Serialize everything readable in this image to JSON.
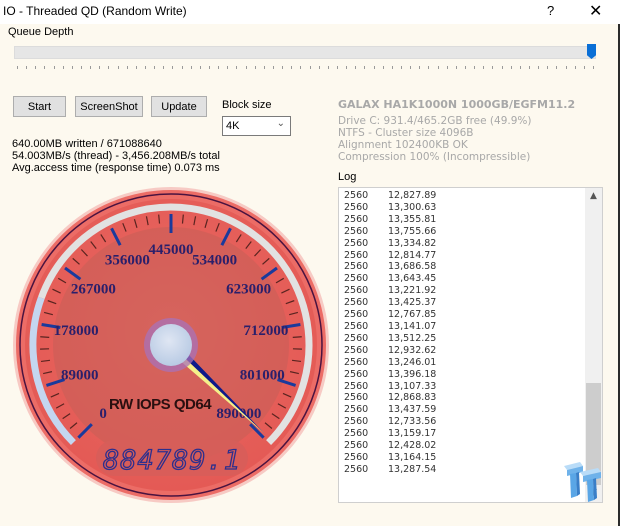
{
  "window": {
    "title": "IO - Threaded QD (Random Write)",
    "help_glyph": "?",
    "close_glyph": "✕"
  },
  "queue_depth": {
    "label": "Queue Depth",
    "slider_value_fraction": 1.0
  },
  "buttons": {
    "start": "Start",
    "screenshot": "ScreenShot",
    "update": "Update"
  },
  "block_size": {
    "label": "Block size",
    "selected": "4K"
  },
  "stats": {
    "written": "640.00MB written / 671088640",
    "throughput": "54.003MB/s (thread) - 3,456.208MB/s total",
    "access_time": "Avg.access time (response time) 0.073 ms"
  },
  "drive": {
    "title": "GALAX HA1K1000N 1000GB/EGFM11.2",
    "lines": [
      "Drive C: 931.4/465.2GB free (49.9%)",
      "NTFS - Cluster size 4096B",
      "Alignment 102400KB OK",
      "Compression 100% (Incompressible)"
    ]
  },
  "log": {
    "label": "Log",
    "rows": [
      [
        "2560",
        "12,827.89"
      ],
      [
        "2560",
        "13,300.63"
      ],
      [
        "2560",
        "13,355.81"
      ],
      [
        "2560",
        "13,755.66"
      ],
      [
        "2560",
        "13,334.82"
      ],
      [
        "2560",
        "12,814.77"
      ],
      [
        "2560",
        "13,686.58"
      ],
      [
        "2560",
        "13,643.45"
      ],
      [
        "2560",
        "13,221.92"
      ],
      [
        "2560",
        "13,425.37"
      ],
      [
        "2560",
        "12,767.85"
      ],
      [
        "2560",
        "13,141.07"
      ],
      [
        "2560",
        "13,512.25"
      ],
      [
        "2560",
        "12,932.62"
      ],
      [
        "2560",
        "13,246.01"
      ],
      [
        "2560",
        "13,396.18"
      ],
      [
        "2560",
        "13,107.33"
      ],
      [
        "2560",
        "12,868.83"
      ],
      [
        "2560",
        "13,437.59"
      ],
      [
        "2560",
        "12,733.56"
      ],
      [
        "2560",
        "13,159.17"
      ],
      [
        "2560",
        "12,428.02"
      ],
      [
        "2560",
        "13,164.15"
      ],
      [
        "2560",
        "13,287.54"
      ]
    ]
  },
  "gauge": {
    "caption": "RW IOPS QD64",
    "readout": "884789.1",
    "value": 884789.1,
    "min": 0,
    "max": 890000,
    "tick_labels": [
      "0",
      "89000",
      "178000",
      "267000",
      "356000",
      "445000",
      "534000",
      "623000",
      "712000",
      "801000",
      "890000"
    ],
    "colors": {
      "face": "#e8645f",
      "inner": "#c85e59",
      "tick_major": "#1a3a9c",
      "label": "#2a1f6b",
      "needle": "#0d1a8a",
      "needle_highlight": "#f4f08a"
    }
  },
  "icons": {
    "watermark": "tweaktown-logo-icon"
  }
}
